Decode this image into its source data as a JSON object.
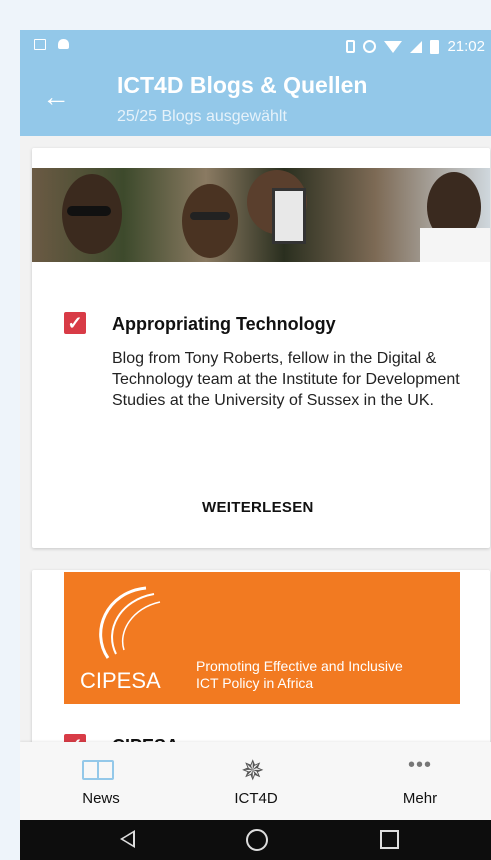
{
  "status_bar": {
    "time": "21:02",
    "icons": [
      "image-icon",
      "android-icon",
      "vibrate-icon",
      "alarm-icon",
      "wifi-icon",
      "signal-icon",
      "battery-icon"
    ]
  },
  "appbar": {
    "back_icon": "arrow-left-icon",
    "title": "ICT4D Blogs & Quellen",
    "subtitle": "25/25 Blogs ausgewählt"
  },
  "cards": [
    {
      "title": "Appropriating Technology",
      "description": "Blog from Tony Roberts, fellow in the Digital & Technology team at the Institute for Development Studies at the University of Sussex in the UK.",
      "checked": true,
      "action": "WEITERLESEN"
    },
    {
      "title": "CIPESA",
      "logo_name": "CIPESA",
      "logo_tagline_1": "Promoting Effective and Inclusive",
      "logo_tagline_2": "ICT Policy in Africa",
      "checked": true
    }
  ],
  "bottom_nav": [
    {
      "label": "News",
      "icon": "book-icon"
    },
    {
      "label": "ICT4D",
      "icon": "star-icon"
    },
    {
      "label": "Mehr",
      "icon": "more-dots-icon"
    }
  ],
  "colors": {
    "primary": "#93c8e9",
    "accent": "#d83b46",
    "cipesa_orange": "#f27a21"
  }
}
